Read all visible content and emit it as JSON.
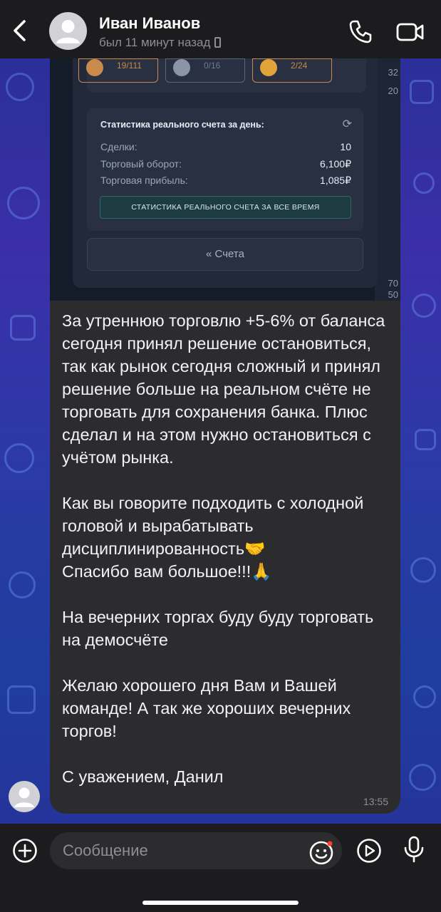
{
  "header": {
    "back_icon": "chevron-left-icon",
    "contact_name": "Иван Иванов",
    "status": "был 11 минут назад",
    "call_icon": "phone-icon",
    "video_icon": "video-camera-icon"
  },
  "screenshot": {
    "medals": [
      {
        "value": "19/111",
        "color": "#c98a4b"
      },
      {
        "value": "0/16",
        "color": "#8b95a8"
      },
      {
        "value": "2/24",
        "color": "#e0a43a"
      }
    ],
    "side_numbers_top": [
      "32",
      "20"
    ],
    "side_numbers_bottom": [
      "70",
      "50"
    ],
    "stats_title": "Статистика реального счета за день:",
    "stats_rows": [
      {
        "label": "Сделки:",
        "value": "10"
      },
      {
        "label": "Торговый оборот:",
        "value": "6,100₽"
      },
      {
        "label": "Торговая прибыль:",
        "value": "1,085₽"
      }
    ],
    "all_time_button": "СТАТИСТИКА РЕАЛЬНОГО СЧЕТА ЗА ВСЕ ВРЕМЯ",
    "accounts_button": "« Счета"
  },
  "message": {
    "text": "За утреннюю торговлю +5-6% от баланса сегодня принял решение остановиться, так как рынок сегодня сложный и принял решение больше на реальном счёте не торговать для сохранения банка. Плюс сделал и на этом нужно остановиться с учётом рынка.\n\nКак вы говорите подходить с холодной головой и вырабатывать дисциплинированность🤝\nСпасибо вам большое!!!🙏\n\nНа вечерних торгах буду буду торговать на демосчёте\n\nЖелаю хорошего дня Вам и Вашей команде! А так же хороших вечерних торгов!\n\nС уважением, Данил",
    "time": "13:55"
  },
  "input": {
    "placeholder": "Сообщение",
    "add_icon": "plus-circle-icon",
    "emoji_icon": "emoji-icon",
    "video_message_icon": "play-icon",
    "mic_icon": "microphone-icon"
  },
  "colors": {
    "header_bg": "#1c1c1e",
    "bubble_bg": "#2c2c2e",
    "accent": "#0a84ff"
  }
}
